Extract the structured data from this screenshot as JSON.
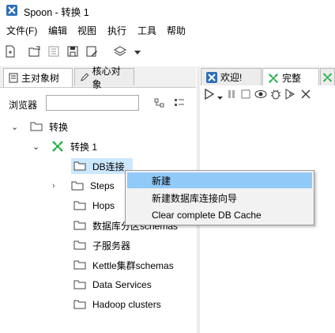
{
  "window": {
    "title": "Spoon - 转换 1"
  },
  "menu": [
    "文件(F)",
    "编辑",
    "视图",
    "执行",
    "工具",
    "帮助"
  ],
  "left_tabs": [
    "主对象树",
    "核心对象"
  ],
  "browser": {
    "label": "浏览器",
    "value": ""
  },
  "tree": {
    "root": "转换",
    "transform": "转换 1",
    "items": [
      "DB连接",
      "Steps",
      "Hops",
      "数据库分区schemas",
      "子服务器",
      "Kettle集群schemas",
      "Data Services",
      "Hadoop clusters"
    ]
  },
  "right_tabs": [
    "欢迎!",
    "完整"
  ],
  "context_menu": [
    "新建",
    "新建数据库连接向导",
    "Clear complete DB Cache"
  ],
  "colors": {
    "selection": "#cce8ff",
    "menu_highlight": "#91c9f7",
    "transform_icon": "#2bb24c",
    "app_icon": "#2f6fb5"
  }
}
